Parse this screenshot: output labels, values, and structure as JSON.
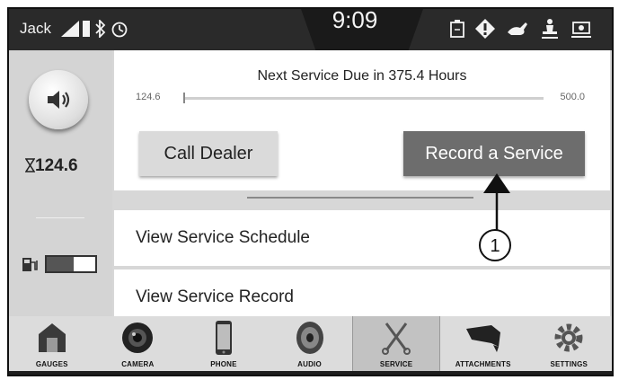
{
  "status_bar": {
    "user": "Jack",
    "time": "9:09"
  },
  "left_panel": {
    "hours_icon": "hourglass-icon",
    "hours": "124.6",
    "fuel_level": 0.55
  },
  "service": {
    "title": "Next Service Due in 375.4 Hours",
    "range_min": "124.6",
    "range_max": "500.0",
    "progress_fraction": 0.0,
    "call_dealer_label": "Call Dealer",
    "record_service_label": "Record a Service"
  },
  "menu": {
    "view_schedule_label": "View Service Schedule",
    "view_record_label": "View Service Record"
  },
  "callout": {
    "label": "1"
  },
  "nav": {
    "items": [
      {
        "label": "GAUGES",
        "icon": "gauges-icon"
      },
      {
        "label": "CAMERA",
        "icon": "camera-icon"
      },
      {
        "label": "PHONE",
        "icon": "phone-icon"
      },
      {
        "label": "AUDIO",
        "icon": "audio-icon"
      },
      {
        "label": "SERVICE",
        "icon": "service-icon",
        "active": true
      },
      {
        "label": "ATTACHMENTS",
        "icon": "attachments-icon"
      },
      {
        "label": "SETTINGS",
        "icon": "settings-icon"
      }
    ]
  }
}
